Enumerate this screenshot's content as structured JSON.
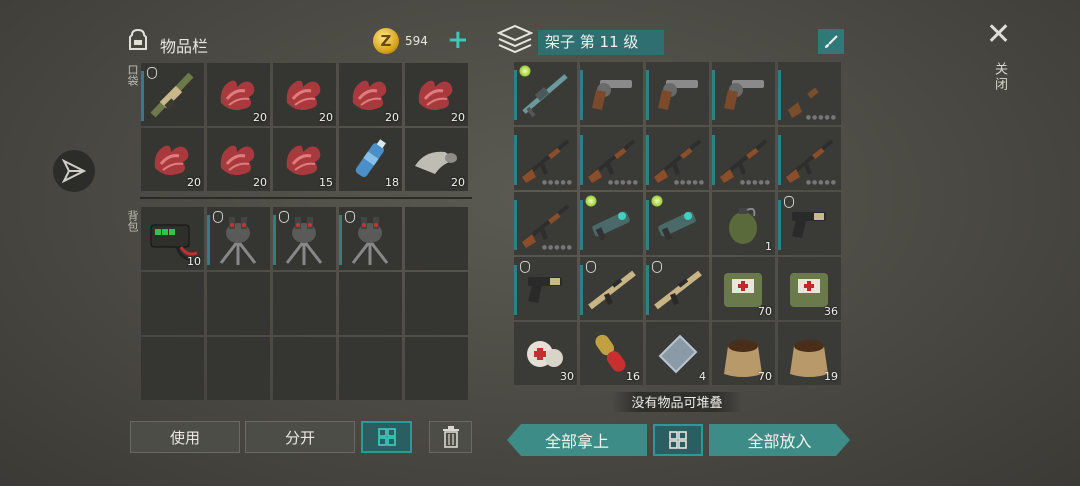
{
  "inventory": {
    "title": "物品栏",
    "coins": "594",
    "pocket_label": "口袋",
    "backpack_label": "背包",
    "pocket_items": [
      {
        "icon": "rocket-launcher-icon",
        "qty": "",
        "tag": "shield",
        "bar": true
      },
      {
        "icon": "raw-meat-icon",
        "qty": "20"
      },
      {
        "icon": "raw-meat-icon",
        "qty": "20"
      },
      {
        "icon": "raw-meat-icon",
        "qty": "20"
      },
      {
        "icon": "raw-meat-icon",
        "qty": "20"
      },
      {
        "icon": "raw-meat-icon",
        "qty": "20"
      },
      {
        "icon": "raw-meat-icon",
        "qty": "20"
      },
      {
        "icon": "raw-meat-icon",
        "qty": "15"
      },
      {
        "icon": "water-bottle-icon",
        "qty": "18"
      },
      {
        "icon": "cloth-roll-icon",
        "qty": "20"
      }
    ],
    "backpack_items": [
      {
        "icon": "battery-icon",
        "qty": "10"
      },
      {
        "icon": "turret-icon",
        "qty": "",
        "tag": "shield",
        "bar": true
      },
      {
        "icon": "turret-icon",
        "qty": "",
        "tag": "shield",
        "bar": true
      },
      {
        "icon": "turret-icon",
        "qty": "",
        "tag": "shield",
        "bar": true
      },
      {
        "icon": "empty",
        "qty": ""
      },
      {
        "icon": "empty",
        "qty": ""
      },
      {
        "icon": "empty",
        "qty": ""
      },
      {
        "icon": "empty",
        "qty": ""
      },
      {
        "icon": "empty",
        "qty": ""
      },
      {
        "icon": "empty",
        "qty": ""
      },
      {
        "icon": "empty",
        "qty": ""
      },
      {
        "icon": "empty",
        "qty": ""
      },
      {
        "icon": "empty",
        "qty": ""
      },
      {
        "icon": "empty",
        "qty": ""
      },
      {
        "icon": "empty",
        "qty": ""
      }
    ],
    "use_label": "使用",
    "split_label": "分开"
  },
  "shelf": {
    "title": "架子 第 11 级",
    "items": [
      {
        "icon": "energy-rifle-icon",
        "qty": "",
        "tag": "glow",
        "bar": true
      },
      {
        "icon": "revolver-icon",
        "qty": "",
        "bar": true
      },
      {
        "icon": "revolver-icon",
        "qty": "",
        "bar": true
      },
      {
        "icon": "revolver-icon",
        "qty": "",
        "bar": true
      },
      {
        "icon": "shotgun-icon",
        "qty": "",
        "bar": true,
        "stars": true
      },
      {
        "icon": "assault-rifle-icon",
        "qty": "",
        "bar": true,
        "stars": true
      },
      {
        "icon": "assault-rifle-icon",
        "qty": "",
        "bar": true,
        "stars": true
      },
      {
        "icon": "assault-rifle-icon",
        "qty": "",
        "bar": true,
        "stars": true
      },
      {
        "icon": "assault-rifle-icon",
        "qty": "",
        "bar": true,
        "stars": true
      },
      {
        "icon": "assault-rifle-icon",
        "qty": "",
        "bar": true,
        "stars": true
      },
      {
        "icon": "assault-rifle-icon",
        "qty": "",
        "bar": true,
        "stars": true
      },
      {
        "icon": "plasma-gun-icon",
        "qty": "",
        "tag": "glow",
        "bar": true
      },
      {
        "icon": "plasma-gun-icon",
        "qty": "",
        "tag": "glow",
        "bar": true
      },
      {
        "icon": "grenade-icon",
        "qty": "1"
      },
      {
        "icon": "pistol-icon",
        "qty": "",
        "tag": "shield",
        "bar": true
      },
      {
        "icon": "pistol-icon",
        "qty": "",
        "tag": "shield",
        "bar": true
      },
      {
        "icon": "tan-rifle-icon",
        "qty": "",
        "tag": "shield",
        "bar": true
      },
      {
        "icon": "tan-rifle-icon",
        "qty": "",
        "tag": "shield",
        "bar": true
      },
      {
        "icon": "medkit-bag-icon",
        "qty": "70"
      },
      {
        "icon": "medkit-bag-icon",
        "qty": "36"
      },
      {
        "icon": "bandage-icon",
        "qty": "30"
      },
      {
        "icon": "capsule-icon",
        "qty": "16"
      },
      {
        "icon": "metal-plate-icon",
        "qty": "4"
      },
      {
        "icon": "seed-sack-icon",
        "qty": "70"
      },
      {
        "icon": "seed-sack-icon",
        "qty": "19"
      }
    ],
    "toast": "没有物品可堆叠",
    "take_all_label": "全部拿上",
    "put_all_label": "全部放入"
  },
  "close_label": "关闭"
}
